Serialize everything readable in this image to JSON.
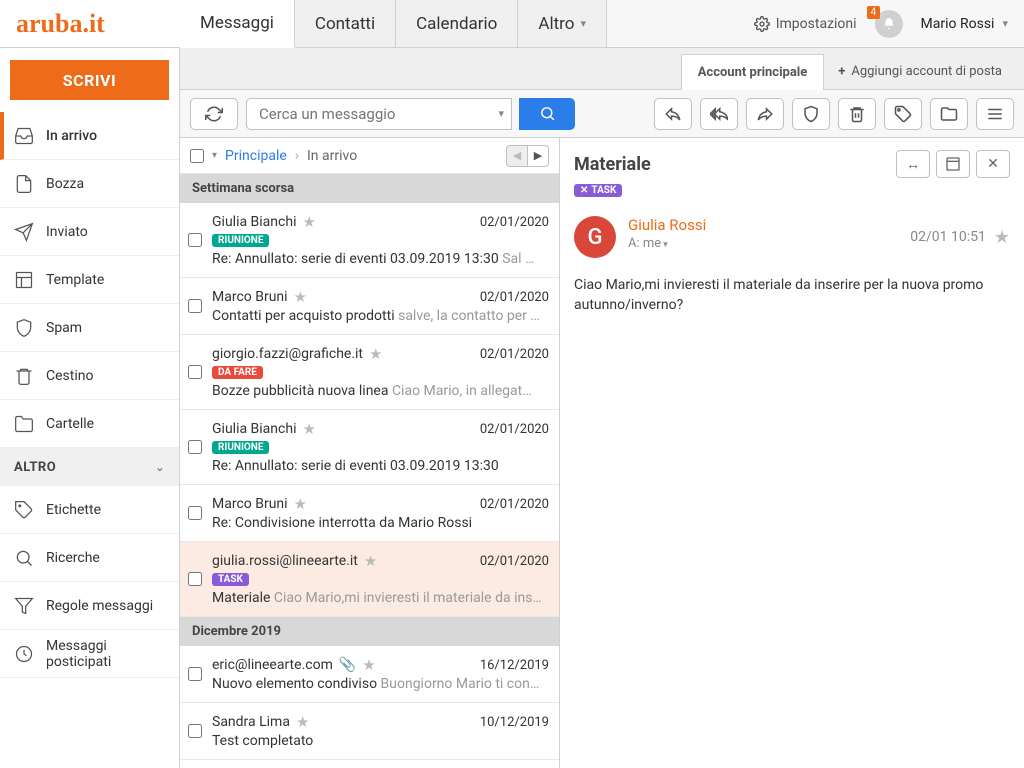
{
  "logo": "aruba.it",
  "header": {
    "tabs": [
      "Messaggi",
      "Contatti",
      "Calendario",
      "Altro"
    ],
    "active_tab": 0,
    "settings": "Impostazioni",
    "notif_count": "4",
    "user": "Mario Rossi"
  },
  "sidebar": {
    "compose": "SCRIVI",
    "folders": [
      {
        "label": "In arrivo",
        "icon": "inbox",
        "active": true
      },
      {
        "label": "Bozza",
        "icon": "draft"
      },
      {
        "label": "Inviato",
        "icon": "sent"
      },
      {
        "label": "Template",
        "icon": "template"
      },
      {
        "label": "Spam",
        "icon": "spam"
      },
      {
        "label": "Cestino",
        "icon": "trash"
      },
      {
        "label": "Cartelle",
        "icon": "folder"
      }
    ],
    "section": "ALTRO",
    "other": [
      {
        "label": "Etichette",
        "icon": "tag"
      },
      {
        "label": "Ricerche",
        "icon": "search"
      },
      {
        "label": "Regole messaggi",
        "icon": "filter"
      },
      {
        "label": "Messaggi posticipati",
        "icon": "clock"
      }
    ]
  },
  "account": {
    "main": "Account principale",
    "add": "Aggiungi account di posta"
  },
  "search": {
    "placeholder": "Cerca un messaggio"
  },
  "breadcrumb": {
    "root": "Principale",
    "current": "In arrivo"
  },
  "groups": [
    {
      "label": "Settimana scorsa",
      "messages": [
        {
          "from": "Giulia Bianchi",
          "date": "02/01/2020",
          "tag": "RIUNIONE",
          "tagcls": "riunione",
          "subject": "Re: Annullato: serie di eventi 03.09.2019 13:30",
          "preview": "Sal …"
        },
        {
          "from": "Marco Bruni",
          "date": "02/01/2020",
          "subject": "Contatti per acquisto prodotti",
          "preview": "salve, la contatto per …"
        },
        {
          "from": "giorgio.fazzi@grafiche.it",
          "date": "02/01/2020",
          "tag": "DA FARE",
          "tagcls": "dafare",
          "subject": "Bozze pubblicità nuova linea",
          "preview": "Ciao Mario, in allegat…"
        },
        {
          "from": "Giulia Bianchi",
          "date": "02/01/2020",
          "tag": "RIUNIONE",
          "tagcls": "riunione",
          "subject": "Re: Annullato: serie di eventi 03.09.2019 13:30",
          "preview": ""
        },
        {
          "from": "Marco Bruni",
          "date": "02/01/2020",
          "subject": "Re: Condivisione interrotta da Mario Rossi",
          "preview": ""
        },
        {
          "from": "giulia.rossi@lineearte.it",
          "date": "02/01/2020",
          "tag": "TASK",
          "tagcls": "task",
          "subject": "Materiale",
          "preview": "Ciao Mario,mi invieresti il materiale da ins…",
          "selected": true
        }
      ]
    },
    {
      "label": "Dicembre 2019",
      "messages": [
        {
          "from": "eric@lineearte.com",
          "date": "16/12/2019",
          "attach": true,
          "subject": "Nuovo elemento condiviso",
          "preview": "Buongiorno Mario ti con…"
        },
        {
          "from": "Sandra Lima",
          "date": "10/12/2019",
          "subject": "Test completato",
          "preview": ""
        }
      ]
    }
  ],
  "reader": {
    "subject": "Materiale",
    "tag": "TASK",
    "from": "Giulia Rossi",
    "avatar": "G",
    "to_label": "A:",
    "to": "me",
    "date": "02/01 10:51",
    "body": "Ciao Mario,mi invieresti il materiale da inserire per la nuova promo autunno/inverno?"
  }
}
